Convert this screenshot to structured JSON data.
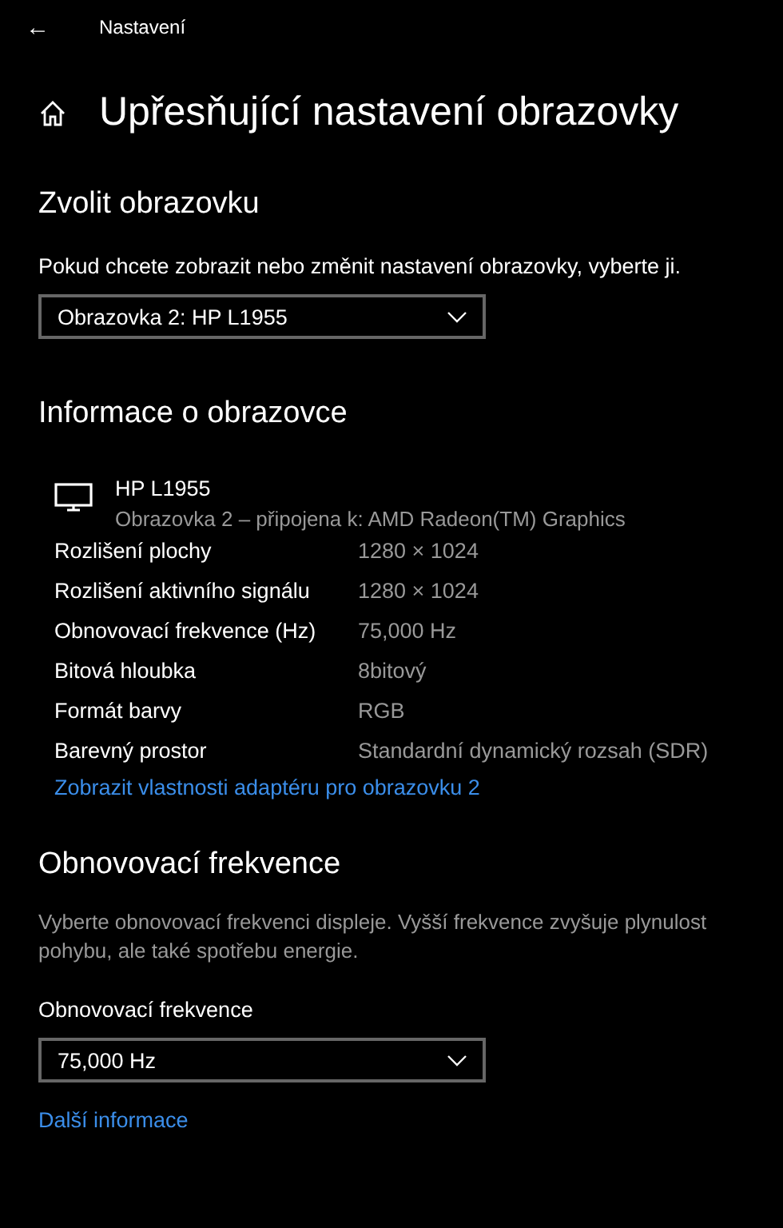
{
  "header": {
    "back": "←",
    "title": "Nastavení"
  },
  "page_title": "Upřesňující nastavení obrazovky",
  "choose_display": {
    "heading": "Zvolit obrazovku",
    "description": "Pokud chcete zobrazit nebo změnit nastavení obrazovky, vyberte ji.",
    "dropdown": {
      "value": "Obrazovka 2: HP L1955"
    }
  },
  "display_info": {
    "heading": "Informace o obrazovce",
    "monitor_name": "HP L1955",
    "monitor_subtitle": "Obrazovka 2 – připojena k: AMD Radeon(TM) Graphics",
    "rows": [
      {
        "label": "Rozlišení plochy",
        "value": "1280 × 1024"
      },
      {
        "label": "Rozlišení aktivního signálu",
        "value": "1280 × 1024"
      },
      {
        "label": "Obnovovací frekvence (Hz)",
        "value": "75,000 Hz"
      },
      {
        "label": "Bitová hloubka",
        "value": "8bitový"
      },
      {
        "label": "Formát barvy",
        "value": "RGB"
      },
      {
        "label": "Barevný prostor",
        "value": "Standardní dynamický rozsah (SDR)"
      }
    ],
    "link": "Zobrazit vlastnosti adaptéru pro obrazovku 2"
  },
  "refresh_rate": {
    "heading": "Obnovovací frekvence",
    "description": "Vyberte obnovovací frekvenci displeje. Vyšší frekvence zvyšuje plynulost pohybu, ale také spotřebu energie.",
    "label": "Obnovovací frekvence",
    "dropdown": {
      "value": "75,000 Hz"
    },
    "link": "Další informace"
  }
}
